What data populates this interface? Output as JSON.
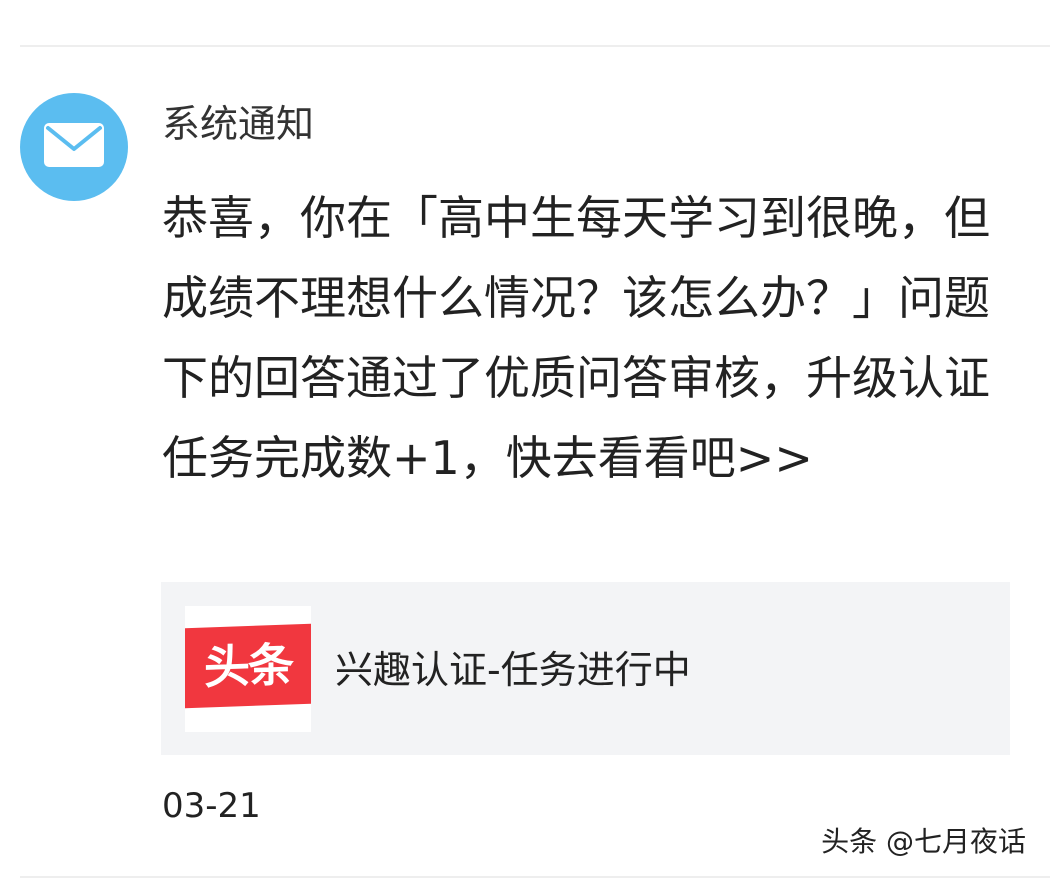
{
  "notification": {
    "sender": "系统通知",
    "avatar_icon": "mail-icon",
    "avatar_color": "#5bbdf0",
    "message": "恭喜，你在「高中生每天学习到很晚，但成绩不理想什么情况？该怎么办？」问题下的回答通过了优质问答审核，升级认证任务完成数+1，快去看看吧>>",
    "card": {
      "logo_text": "头条",
      "logo_color": "#f1373f",
      "title": "兴趣认证-任务进行中"
    },
    "timestamp": "03-21"
  },
  "watermark": "头条 @七月夜话"
}
